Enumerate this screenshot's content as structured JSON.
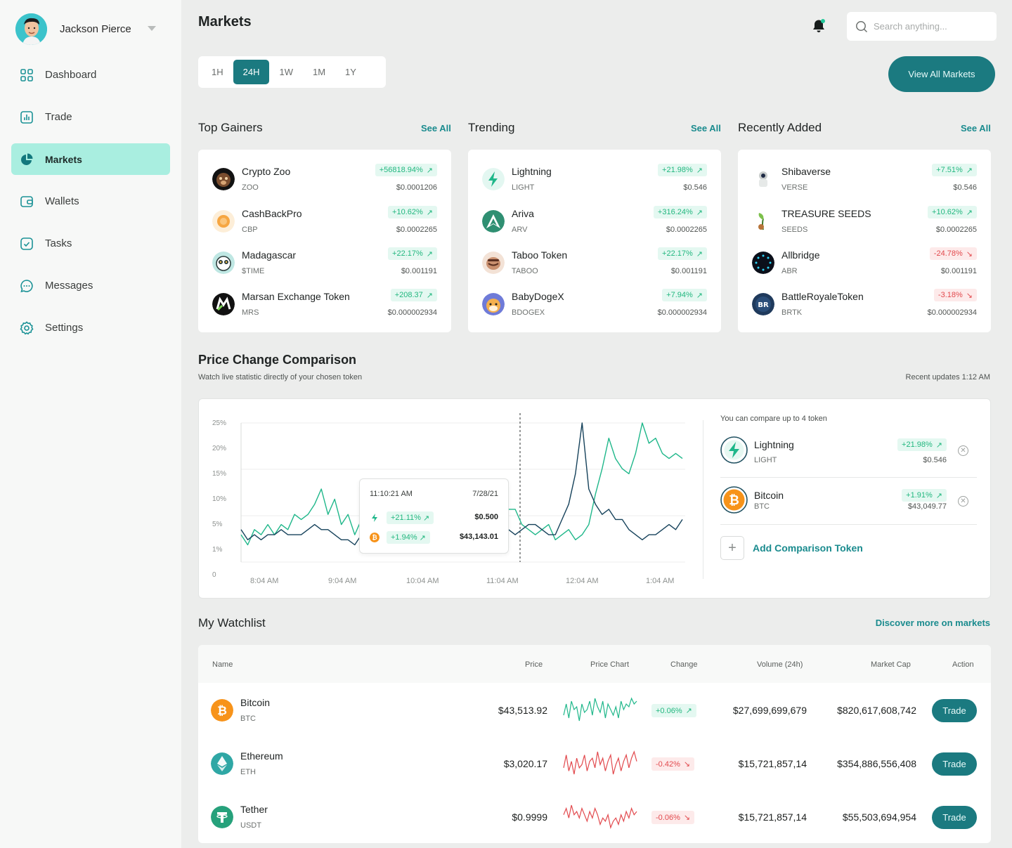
{
  "user": {
    "name": "Jackson Pierce"
  },
  "sidebar": {
    "items": [
      {
        "label": "Dashboard",
        "icon": "grid-icon"
      },
      {
        "label": "Trade",
        "icon": "chart-bar-icon"
      },
      {
        "label": "Markets",
        "icon": "pie-chart-icon",
        "active": true
      },
      {
        "label": "Wallets",
        "icon": "wallet-icon"
      },
      {
        "label": "Tasks",
        "icon": "check-square-icon"
      },
      {
        "label": "Messages",
        "icon": "message-icon"
      },
      {
        "label": "Settings",
        "icon": "gear-icon"
      }
    ]
  },
  "header": {
    "title": "Markets",
    "search_placeholder": "Search anything...",
    "view_all_label": "View All Markets"
  },
  "timeframes": [
    "1H",
    "24H",
    "1W",
    "1M",
    "1Y"
  ],
  "timeframe_active": "24H",
  "sections": {
    "gainers": {
      "title": "Top Gainers",
      "see_all": "See All",
      "items": [
        {
          "name": "Crypto Zoo",
          "symbol": "ZOO",
          "change": "+56818.94%",
          "dir": "up",
          "price": "$0.0001206",
          "color": "#3a2a20"
        },
        {
          "name": "CashBackPro",
          "symbol": "CBP",
          "change": "+10.62%",
          "dir": "up",
          "price": "$0.0002265",
          "color": "#f6b15a"
        },
        {
          "name": "Madagascar",
          "symbol": "$TIME",
          "change": "+22.17%",
          "dir": "up",
          "price": "$0.001191",
          "color": "#6fb6b0"
        },
        {
          "name": "Marsan Exchange Token",
          "symbol": "MRS",
          "change": "+208.37",
          "dir": "up",
          "price": "$0.000002934",
          "color": "#111111"
        }
      ]
    },
    "trending": {
      "title": "Trending",
      "see_all": "See All",
      "items": [
        {
          "name": "Lightning",
          "symbol": "LIGHT",
          "change": "+21.98%",
          "dir": "up",
          "price": "$0.546",
          "color": "#dff7f1"
        },
        {
          "name": "Ariva",
          "symbol": "ARV",
          "change": "+316.24%",
          "dir": "up",
          "price": "$0.0002265",
          "color": "#2f8a6d"
        },
        {
          "name": "Taboo Token",
          "symbol": "TABOO",
          "change": "+22.17%",
          "dir": "up",
          "price": "$0.001191",
          "color": "#c98f6e"
        },
        {
          "name": "BabyDogeX",
          "symbol": "BDOGEX",
          "change": "+7.94%",
          "dir": "up",
          "price": "$0.000002934",
          "color": "#f0b24e"
        }
      ]
    },
    "recent": {
      "title": "Recently Added",
      "see_all": "See All",
      "items": [
        {
          "name": "Shibaverse",
          "symbol": "VERSE",
          "change": "+7.51%",
          "dir": "up",
          "price": "$0.546",
          "color": "#cfd3d2"
        },
        {
          "name": "TREASURE SEEDS",
          "symbol": "SEEDS",
          "change": "+10.62%",
          "dir": "up",
          "price": "$0.0002265",
          "color": "#7cc04b"
        },
        {
          "name": "Allbridge",
          "symbol": "ABR",
          "change": "-24.78%",
          "dir": "down",
          "price": "$0.001191",
          "color": "#0b0f1a"
        },
        {
          "name": "BattleRoyaleToken",
          "symbol": "BRTK",
          "change": "-3.18%",
          "dir": "down",
          "price": "$0.000002934",
          "color": "#1f3a5c"
        }
      ]
    }
  },
  "comparison": {
    "title": "Price Change Comparison",
    "subtitle": "Watch live statistic directly of your chosen token",
    "updated": "Recent updates 1:12 AM",
    "note": "You can compare up to 4 token",
    "add_label": "Add Comparison Token",
    "tokens": [
      {
        "name": "Lightning",
        "symbol": "LIGHT",
        "change": "+21.98%",
        "price": "$0.546",
        "color": "#1fb78a"
      },
      {
        "name": "Bitcoin",
        "symbol": "BTC",
        "change": "+1.91%",
        "price": "$43,049.77",
        "color": "#f7931a"
      }
    ],
    "tooltip": {
      "time": "11:10:21 AM",
      "date": "7/28/21",
      "rows": [
        {
          "change": "+21.11%",
          "value": "$0.500"
        },
        {
          "change": "+1.94%",
          "value": "$43,143.01"
        }
      ]
    }
  },
  "chart_data": {
    "type": "line",
    "x": [
      "8:04 AM",
      "9:04 AM",
      "10:04 AM",
      "11:04 AM",
      "12:04 AM",
      "1:04 AM"
    ],
    "xlabel": "",
    "ylabel": "",
    "y_ticks": [
      "0",
      "1%",
      "5%",
      "10%",
      "15%",
      "20%",
      "25%"
    ],
    "series": [
      {
        "name": "Lightning",
        "color": "#1fb78a",
        "values": [
          4,
          2,
          5,
          4,
          6,
          4,
          6,
          5,
          8,
          7,
          8,
          10,
          13,
          8,
          11,
          6,
          8,
          4,
          7,
          5,
          8,
          9,
          6,
          6,
          8,
          7,
          9,
          10,
          7,
          6,
          8,
          9,
          11,
          10,
          8,
          7,
          6,
          9,
          7,
          6,
          9,
          9,
          6,
          5,
          4,
          5,
          6,
          3,
          4,
          5,
          3,
          4,
          6,
          12,
          17,
          23,
          19,
          17,
          16,
          20,
          26,
          22,
          23,
          20,
          19,
          20,
          19
        ]
      },
      {
        "name": "Bitcoin",
        "color": "#16425b",
        "values": [
          5,
          3,
          4,
          3,
          4,
          4,
          5,
          4,
          4,
          4,
          5,
          6,
          5,
          5,
          4,
          3,
          3,
          2,
          4,
          3,
          4,
          4,
          3,
          3,
          4,
          3,
          4,
          5,
          4,
          4,
          4,
          4,
          5,
          5,
          5,
          4,
          4,
          4,
          5,
          5,
          5,
          4,
          5,
          6,
          6,
          5,
          4,
          4,
          7,
          10,
          16,
          26,
          13,
          10,
          8,
          9,
          7,
          7,
          5,
          4,
          3,
          4,
          4,
          5,
          6,
          5,
          7
        ]
      }
    ]
  },
  "watchlist": {
    "title": "My Watchlist",
    "more_label": "Discover more on markets",
    "headers": {
      "name": "Name",
      "price": "Price",
      "chart": "Price Chart",
      "change": "Change",
      "volume": "Volume (24h)",
      "cap": "Market Cap",
      "action": "Action"
    },
    "rows": [
      {
        "name": "Bitcoin",
        "symbol": "BTC",
        "price": "$43,513.92",
        "change": "+0.06%",
        "dir": "up",
        "volume": "$27,699,699,679",
        "cap": "$820,617,608,742",
        "action": "Trade",
        "color": "#f7931a",
        "spark": [
          4,
          8,
          3,
          9,
          6,
          7,
          2,
          8,
          5,
          6,
          9,
          4,
          10,
          7,
          5,
          9,
          3,
          8,
          6,
          4,
          7,
          3,
          9,
          6,
          8,
          7,
          10,
          8,
          9
        ]
      },
      {
        "name": "Ethereum",
        "symbol": "ETH",
        "price": "$3,020.17",
        "change": "-0.42%",
        "dir": "down",
        "volume": "$15,721,857,14",
        "cap": "$354,886,556,408",
        "action": "Trade",
        "color": "#39a9a7",
        "spark": [
          5,
          9,
          4,
          7,
          3,
          8,
          5,
          6,
          9,
          4,
          7,
          8,
          5,
          10,
          6,
          8,
          4,
          7,
          9,
          3,
          6,
          8,
          4,
          7,
          9,
          5,
          8,
          10,
          7
        ]
      },
      {
        "name": "Tether",
        "symbol": "USDT",
        "price": "$0.9999",
        "change": "-0.06%",
        "dir": "down",
        "volume": "$15,721,857,14",
        "cap": "$55,503,694,954",
        "action": "Trade",
        "color": "#26a17b",
        "spark": [
          7,
          9,
          6,
          10,
          7,
          8,
          6,
          9,
          7,
          5,
          8,
          6,
          9,
          7,
          4,
          6,
          5,
          7,
          3,
          5,
          6,
          4,
          7,
          5,
          8,
          6,
          9,
          7,
          8
        ]
      }
    ]
  }
}
